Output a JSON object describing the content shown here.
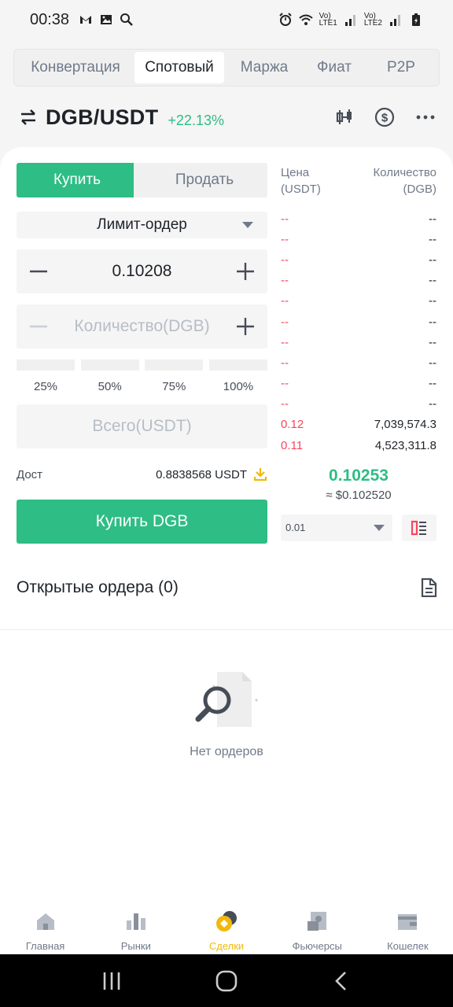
{
  "status_bar": {
    "time": "00:38",
    "sim1": "Vo)\nLTE1",
    "sim2": "Vo)\nLTE2"
  },
  "tabs": [
    {
      "label": "Конвертация",
      "active": false
    },
    {
      "label": "Спотовый",
      "active": true
    },
    {
      "label": "Маржа",
      "active": false
    },
    {
      "label": "Фиат",
      "active": false
    },
    {
      "label": "P2P",
      "active": false
    }
  ],
  "pair": {
    "name": "DGB/USDT",
    "change": "+22.13%"
  },
  "trade": {
    "buy_label": "Купить",
    "sell_label": "Продать",
    "order_type": "Лимит-ордер",
    "price_value": "0.10208",
    "amount_placeholder": "Количество(DGB)",
    "percents": [
      "25%",
      "50%",
      "75%",
      "100%"
    ],
    "total_placeholder": "Всего(USDT)",
    "available_label": "Дост",
    "available_value": "0.8838568 USDT",
    "buy_button": "Купить DGB"
  },
  "orderbook": {
    "price_header": "Цена\n(USDT)",
    "qty_header": "Количество\n(DGB)",
    "rows": [
      {
        "price": "--",
        "qty": "--"
      },
      {
        "price": "--",
        "qty": "--"
      },
      {
        "price": "--",
        "qty": "--"
      },
      {
        "price": "--",
        "qty": "--"
      },
      {
        "price": "--",
        "qty": "--"
      },
      {
        "price": "--",
        "qty": "--"
      },
      {
        "price": "--",
        "qty": "--"
      },
      {
        "price": "--",
        "qty": "--"
      },
      {
        "price": "--",
        "qty": "--"
      },
      {
        "price": "--",
        "qty": "--"
      },
      {
        "price": "0.12",
        "qty": "7,039,574.3"
      },
      {
        "price": "0.11",
        "qty": "4,523,311.8"
      }
    ],
    "last_price": "0.10253",
    "last_price_usd": "≈ $0.102520",
    "precision": "0.01"
  },
  "open_orders": {
    "title": "Открытые ордера (0)",
    "empty_text": "Нет ордеров"
  },
  "bottom_nav": [
    {
      "label": "Главная",
      "icon": "home-icon",
      "active": false
    },
    {
      "label": "Рынки",
      "icon": "markets-icon",
      "active": false
    },
    {
      "label": "Сделки",
      "icon": "trades-icon",
      "active": true
    },
    {
      "label": "Фьючерсы",
      "icon": "futures-icon",
      "active": false
    },
    {
      "label": "Кошелек",
      "icon": "wallet-icon",
      "active": false
    }
  ],
  "colors": {
    "buy_green": "#2ebd85",
    "sell_red": "#f6465d",
    "accent_yellow": "#f0b90b"
  }
}
